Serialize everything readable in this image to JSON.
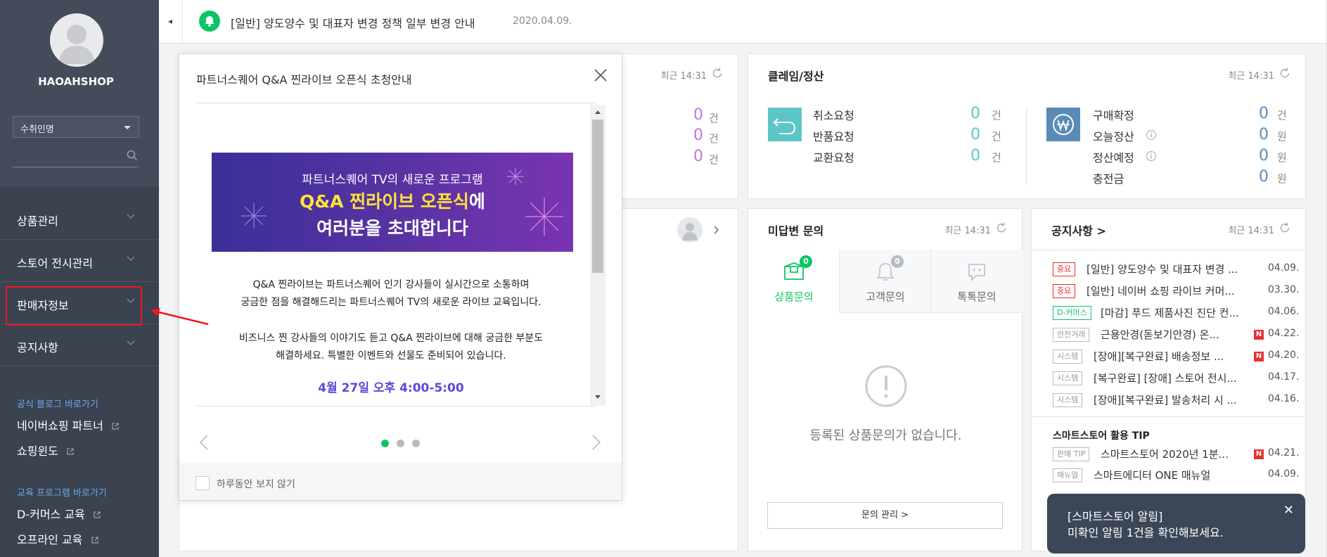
{
  "sidebar": {
    "shop_name": "HAOAHSHOP",
    "select_value": "수취인명",
    "nav": [
      {
        "label": "상품관리"
      },
      {
        "label": "스토어 전시관리"
      },
      {
        "label": "판매자정보"
      },
      {
        "label": "공지사항"
      }
    ],
    "blog_section": "공식 블로그 바로가기",
    "blog_links": [
      "네이버쇼핑 파트너",
      "쇼핑윈도"
    ],
    "edu_section": "교육 프로그램 바로가기",
    "edu_links": [
      "D-커머스 교육",
      "오프라인 교육"
    ]
  },
  "notice_bar": {
    "text": "[일반] 양도양수 및 대표자 변경 정책 일부 변경 안내",
    "date": "2020.04.09."
  },
  "left_card": {
    "recent": "최근 14:31",
    "rows": [
      {
        "value": "0",
        "unit": "건"
      },
      {
        "value": "0",
        "unit": "건"
      },
      {
        "value": "0",
        "unit": "건"
      }
    ],
    "accent": "#c277dd"
  },
  "claim": {
    "title": "클레임/정산",
    "recent": "최근 14:31",
    "left_rows": [
      {
        "label": "취소요청",
        "value": "0",
        "unit": "건"
      },
      {
        "label": "반품요청",
        "value": "0",
        "unit": "건"
      },
      {
        "label": "교환요청",
        "value": "0",
        "unit": "건"
      }
    ],
    "right_rows": [
      {
        "label": "구매확정",
        "value": "0",
        "unit": "건"
      },
      {
        "label": "오늘정산",
        "value": "0",
        "unit": "원"
      },
      {
        "label": "정산예정",
        "value": "0",
        "unit": "원"
      },
      {
        "label": "충전금",
        "value": "0",
        "unit": "원"
      }
    ],
    "claim_color": "#5bc6c7",
    "settle_color": "#5a8bb6"
  },
  "unanswered": {
    "title": "미답변 문의",
    "recent": "최근 14:31",
    "tabs": [
      {
        "label": "상품문의",
        "count": "0"
      },
      {
        "label": "고객문의",
        "count": "0"
      },
      {
        "label": "톡톡문의",
        "count": ""
      }
    ],
    "empty_message": "등록된 상품문의가 없습니다.",
    "manage_button": "문의 관리 >"
  },
  "notices": {
    "title": "공지사항 >",
    "recent": "최근 14:31",
    "items": [
      {
        "tag": "중요",
        "text": "[일반]  양도양수 및 대표자 변경 ...",
        "date": "04.09.",
        "new": false
      },
      {
        "tag": "중요",
        "text": "[일반]  네이버 쇼핑 라이브 커머...",
        "date": "03.30.",
        "new": false
      },
      {
        "tag": "D-커머스",
        "text": "[마감] 푸드 제품사진 진단 컨...",
        "date": "04.06.",
        "new": false
      },
      {
        "tag": "안전거래",
        "text": "근용안경(돋보기안경) 온...",
        "date": "04.22.",
        "new": true
      },
      {
        "tag": "시스템",
        "text": "[장애][복구완료] 배송정보 ...",
        "date": "04.20.",
        "new": true
      },
      {
        "tag": "시스템",
        "text": "[복구완료] [장애] 스토어 전시...",
        "date": "04.17.",
        "new": false
      },
      {
        "tag": "시스템",
        "text": "[장애][복구완료] 발송처리 시 ...",
        "date": "04.16.",
        "new": false
      }
    ],
    "new_badge": "N",
    "tip_title": "스마트스토어 활용 TIP",
    "tips": [
      {
        "tag": "판매 TIP",
        "text": "스마트스토어 2020년 1분...",
        "date": "04.21.",
        "new": true
      },
      {
        "tag": "매뉴얼",
        "text": "스마트에디터 ONE 매뉴얼",
        "date": "04.09.",
        "new": false
      }
    ]
  },
  "modal": {
    "title": "파트너스퀘어 Q&A 찐라이브 오픈식 초청안내",
    "banner_sub": "파트너스퀘어 TV의 새로운 프로그램",
    "banner_highlight": "Q&A 찐라이브 오픈식",
    "banner_highlight_suffix": "에",
    "banner_line2": "여러분을 초대합니다",
    "para1_line1": "Q&A 찐라이브는 파트너스퀘어 인기 강사들이 실시간으로 소통하며",
    "para1_line2": "궁금한 점을 해결해드리는 파트너스퀘어 TV의 새로운 라이브 교육입니다.",
    "para2_line1": "비즈니스 찐 강사들의 이야기도 듣고 Q&A 찐라이브에 대해 궁금한 부분도",
    "para2_line2": "해결하세요. 특별한 이벤트와 선물도 준비되어 있습니다.",
    "time": "4월 27일 오후 4:00-5:00",
    "dont_show": "하루동안 보지 않기"
  },
  "toast": {
    "title": "[스마트스토어 알림]",
    "message": "미확인 알림 1건을 확인해보세요."
  },
  "colors": {
    "brand_green": "#0dc464",
    "sidebar_bg": "#3b4250",
    "highlight_red": "#e8191f"
  }
}
